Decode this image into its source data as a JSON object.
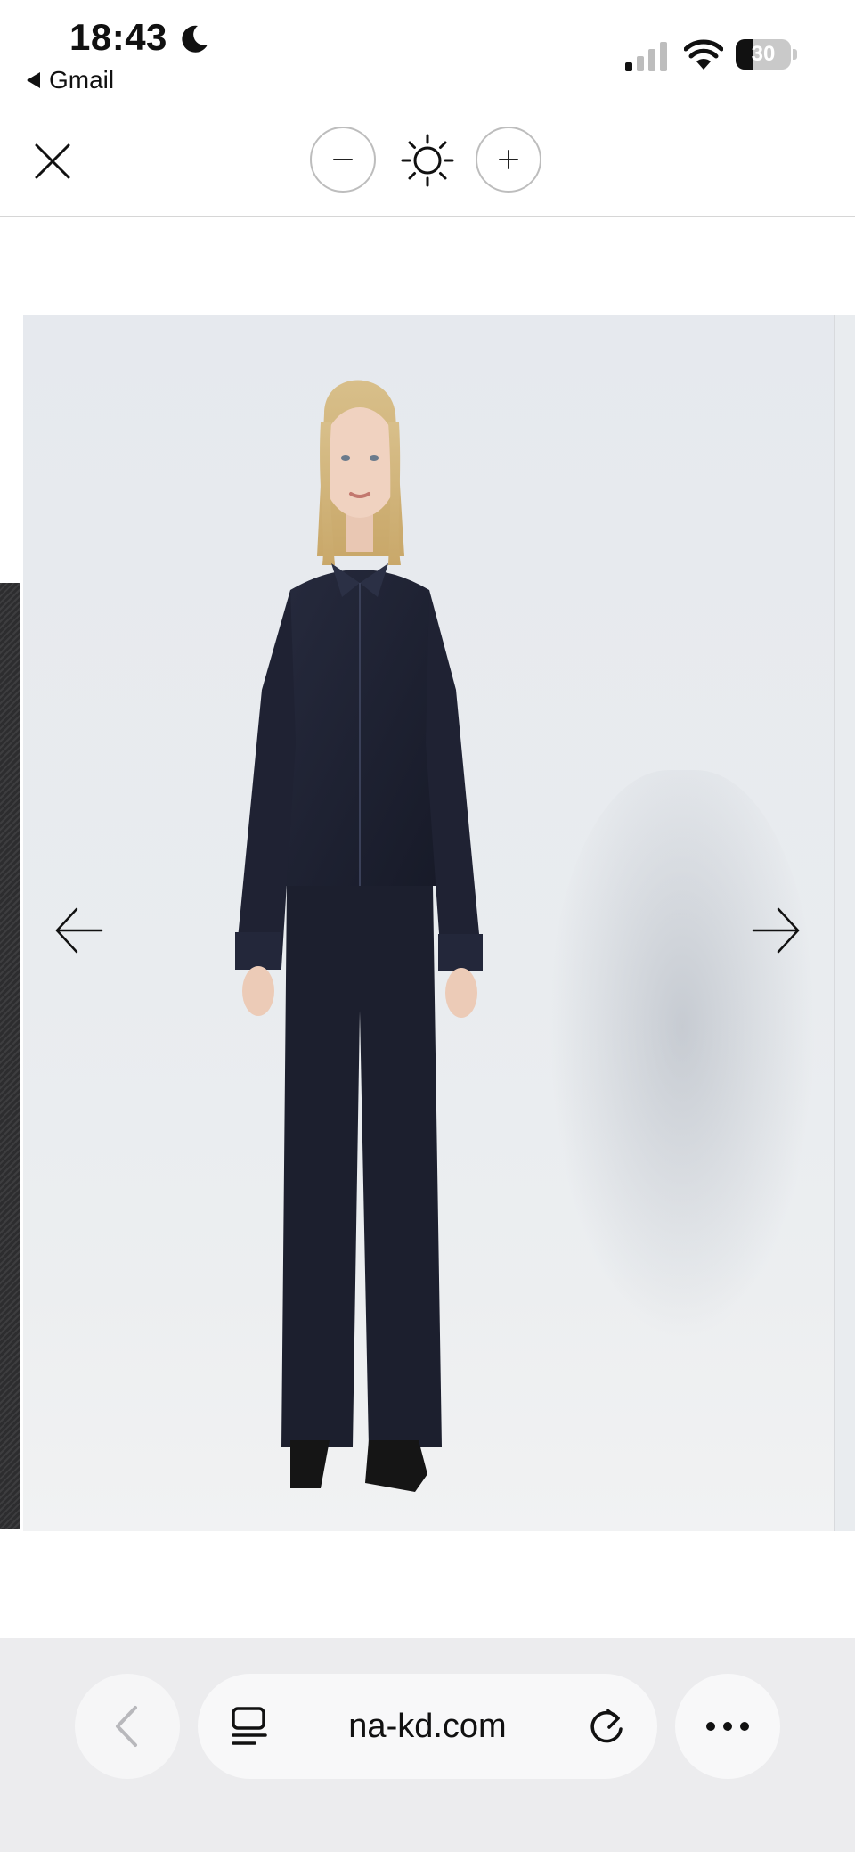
{
  "status_bar": {
    "time": "18:43",
    "back_app": "Gmail",
    "battery_level": "30",
    "battery_fraction": 0.3,
    "icons": [
      "moon-icon",
      "signal-icon",
      "wifi-icon",
      "battery-icon"
    ]
  },
  "viewer_toolbar": {
    "icons": [
      "close-icon",
      "zoom-out-icon",
      "brightness-icon",
      "zoom-in-icon"
    ]
  },
  "gallery": {
    "image_subject": "Model in dark indigo denim shirt and wide-leg denim jeans",
    "icons": [
      "arrow-left-icon",
      "arrow-right-icon"
    ],
    "colors": {
      "denim": "#1f2233",
      "backdrop": "#e7eaee"
    }
  },
  "browser_bar": {
    "url": "na-kd.com",
    "icons": [
      "chevron-left-icon",
      "reader-icon",
      "reload-icon",
      "more-icon"
    ]
  }
}
